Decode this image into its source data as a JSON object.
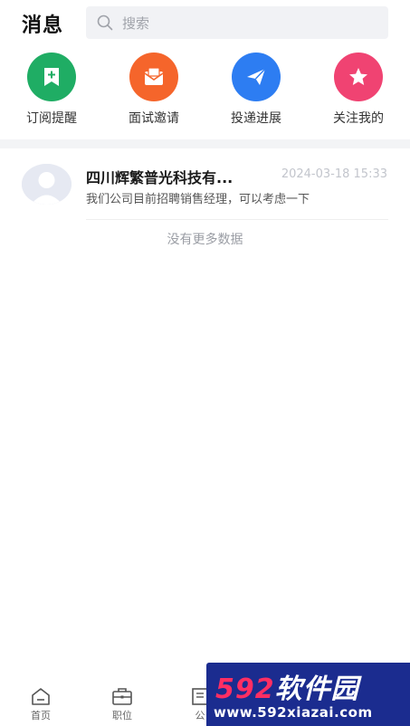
{
  "header": {
    "title": "消息",
    "search_placeholder": "搜索"
  },
  "shortcuts": [
    {
      "label": "订阅提醒",
      "icon": "bookmark-plus-icon",
      "color": "#1fad64"
    },
    {
      "label": "面试邀请",
      "icon": "mail-open-icon",
      "color": "#f5652b"
    },
    {
      "label": "投递进展",
      "icon": "paper-plane-icon",
      "color": "#2d7df2"
    },
    {
      "label": "关注我的",
      "icon": "star-icon",
      "color": "#f04372"
    }
  ],
  "messages": [
    {
      "title": "四川辉繁普光科技有...",
      "time": "2024-03-18 15:33",
      "preview": "我们公司目前招聘销售经理，可以考虑一下"
    }
  ],
  "list_footer": "没有更多数据",
  "bottom_nav": [
    {
      "label": "首页",
      "icon": "home-icon"
    },
    {
      "label": "职位",
      "icon": "briefcase-icon"
    },
    {
      "label": "公",
      "icon": "company-icon"
    }
  ],
  "watermark": {
    "num": "592",
    "brand": "软件园",
    "url": "www.592xiazai.com"
  }
}
